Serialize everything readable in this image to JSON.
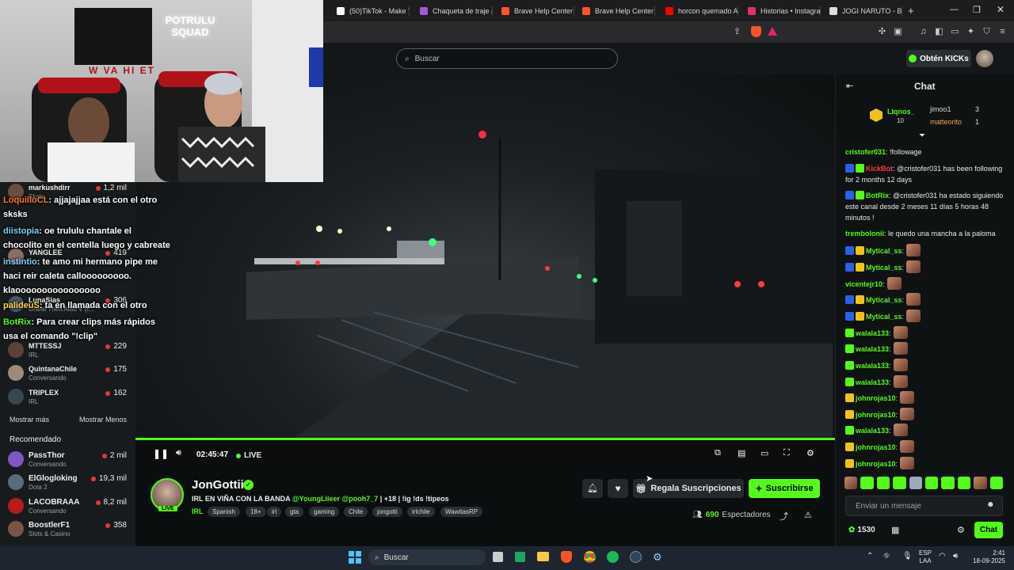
{
  "browser": {
    "tabs": [
      {
        "label": "(50)TikTok - Make Y",
        "color": "#ffffff"
      },
      {
        "label": "Chaqueta de traje a",
        "color": "#a05bd6"
      },
      {
        "label": "Brave Help Center",
        "color": "#fb542b"
      },
      {
        "label": "Brave Help Center",
        "color": "#fb542b"
      },
      {
        "label": "horcon quemado A",
        "color": "#ff0000"
      },
      {
        "label": "Historias • Instagra",
        "color": "#e1306c"
      },
      {
        "label": "JOGI NARUTO - Bus",
        "color": "#dddddd"
      }
    ],
    "new_tab": "+"
  },
  "header": {
    "search_placeholder": "Buscar",
    "kicks_label": "Obtén KICKs"
  },
  "webcam": {
    "neon_sign": "POTRULU SQUAD",
    "banner_text": "W VA HI ET"
  },
  "sidebar": {
    "channels": [
      {
        "name": "markushdirr",
        "category": "Skate.",
        "viewers": "1,2 mil"
      },
      {
        "name": "YANGLEE",
        "category": "",
        "viewers": "419"
      },
      {
        "name": "LunaSias",
        "category": "Grand Theft Auto V (c...",
        "viewers": "306"
      },
      {
        "name": "MTTESSJ",
        "category": "IRL",
        "viewers": "229"
      },
      {
        "name": "QuintanaChile",
        "category": "Conversando",
        "viewers": "175"
      },
      {
        "name": "TRIPLEX",
        "category": "IRL",
        "viewers": "162"
      }
    ],
    "show_more": "Mostrar más",
    "show_less": "Mostrar Menos",
    "recommended_title": "Recomendado",
    "recommended": [
      {
        "name": "PassThor",
        "category": "Conversando",
        "viewers": "2 mil"
      },
      {
        "name": "ElGlogloking",
        "category": "Dota 2",
        "viewers": "19,3 mil"
      },
      {
        "name": "LACOBRAAA",
        "category": "Conversando",
        "viewers": "8,2 mil"
      },
      {
        "name": "BoostlerF1",
        "category": "Slots & Casino",
        "viewers": "358"
      }
    ]
  },
  "overlay_chat": [
    {
      "user": "LoquilloCL",
      "text": ": ajjajajjaa está con el otro sksks",
      "color": "#ff7b29"
    },
    {
      "user": "diistopia",
      "text": ": oe trululu chantale el chocolito en el centella luego y cabreate",
      "color": "#7fd3ff"
    },
    {
      "user": "instintio",
      "text": ": te amo mi hermano pipe me haci reir caleta callooooooooo. klaoooooooooooooooo",
      "color": "#7fd3ff"
    },
    {
      "user": "palideuS",
      "text": ": ta en llamada con el otro",
      "color": "#ffd84a"
    },
    {
      "user": "BotRix",
      "text": ": Para crear clips más rápidos usa el comando \"!clip\"",
      "color": "#53fc18"
    }
  ],
  "player": {
    "time": "02:45:47",
    "live_label": "LIVE",
    "progress": 1.0
  },
  "stream": {
    "streamer": "JonGottii",
    "title": "IRL EN VIÑA CON LA BANDA",
    "mentions": "@YoungLiieer @pooh7_7",
    "title_suffix": "| +18 | !ig !ds !tipeos",
    "category": "IRL",
    "tags": [
      "Spanish",
      "18+",
      "irl",
      "gta",
      "gaming",
      "Chile",
      "jongotti",
      "irlchile",
      "WawitasRP"
    ],
    "gift_label": "Regala Suscripciones",
    "subscribe_label": "Suscribirse",
    "viewers": "690",
    "viewers_label": "Espectadores",
    "live_badge": "LIVE"
  },
  "chat": {
    "title": "Chat",
    "leaderboard": [
      {
        "rank": "1",
        "name": "Llqnos_",
        "count": "10"
      },
      {
        "rank": "",
        "name": "jimoo1",
        "count": "3"
      },
      {
        "rank": "",
        "name": "matteorito",
        "count": "1"
      }
    ],
    "messages": [
      {
        "user": "cristofer031",
        "text": ": !followage",
        "color": "#53fc18"
      },
      {
        "user": "KickBot",
        "text": ": @cristofer031 has been following for 2 months 12 days",
        "color": "#ff3b3b"
      },
      {
        "user": "BotRix",
        "text": ": @cristofer031 ha estado siguiendo este canal desde 2 meses 11 días 5 horas 48 minutos !",
        "color": "#53fc18"
      },
      {
        "user": "trembolonii",
        "text": ": le quedo una mancha a la paloma",
        "color": "#53fc18"
      },
      {
        "user": "Mytical_ss",
        "text": ":",
        "color": "#53fc18"
      },
      {
        "user": "Mytical_ss",
        "text": ":",
        "color": "#53fc18"
      },
      {
        "user": "vicentejr10",
        "text": ":",
        "color": "#53fc18"
      },
      {
        "user": "Mytical_ss",
        "text": ":",
        "color": "#53fc18"
      },
      {
        "user": "Mytical_ss",
        "text": ":",
        "color": "#53fc18"
      },
      {
        "user": "walala133",
        "text": ":",
        "color": "#53fc18"
      },
      {
        "user": "walala133",
        "text": ":",
        "color": "#53fc18"
      },
      {
        "user": "walala133",
        "text": ":",
        "color": "#53fc18"
      },
      {
        "user": "walala133",
        "text": ":",
        "color": "#53fc18"
      },
      {
        "user": "johnrojas10",
        "text": ":",
        "color": "#53fc18"
      },
      {
        "user": "johnrojas10",
        "text": ":",
        "color": "#53fc18"
      },
      {
        "user": "walala133",
        "text": ":",
        "color": "#53fc18"
      },
      {
        "user": "johnrojas10",
        "text": ":",
        "color": "#53fc18"
      },
      {
        "user": "johnrojas10",
        "text": ":",
        "color": "#53fc18"
      }
    ],
    "input_placeholder": "Enviar un mensaje",
    "points": "1530",
    "send_label": "Chat"
  },
  "taskbar": {
    "search_placeholder": "Buscar",
    "lang": "ESP",
    "lang_sub": "LAA",
    "time": "2:41",
    "date": "18-09-2025"
  },
  "colors": {
    "accent": "#53fc18",
    "bg": "#0b0e0f"
  }
}
